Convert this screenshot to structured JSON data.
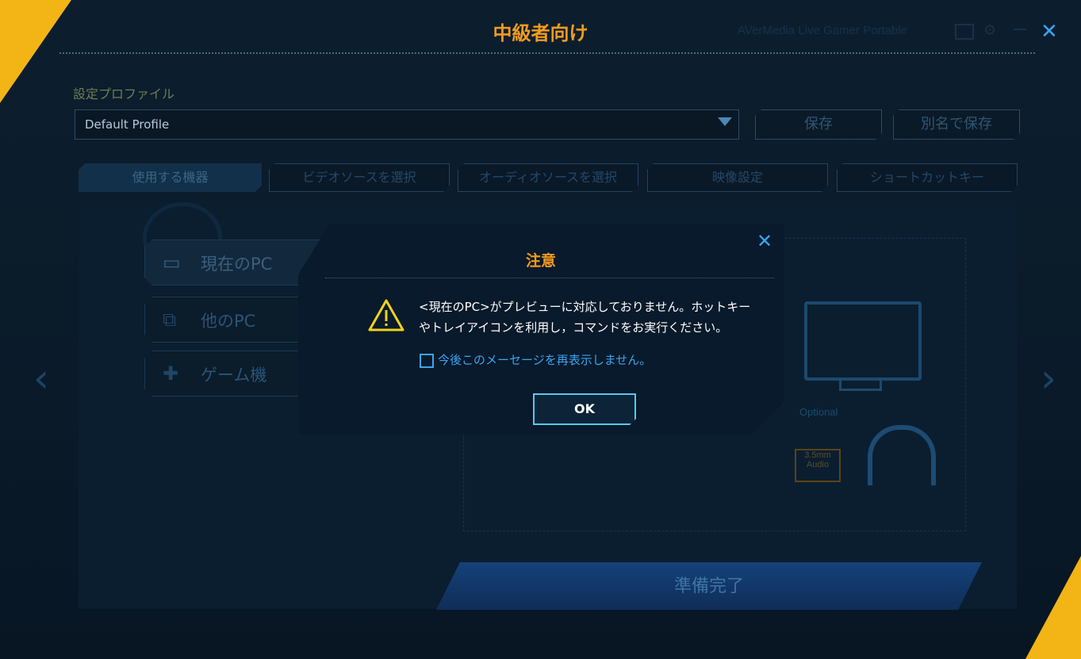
{
  "window": {
    "title": "中級者向け",
    "app_name": "AVerMedia Live Gamer Portable",
    "close_icon": "✕"
  },
  "profile": {
    "label": "設定プロファイル",
    "selected": "Default Profile",
    "save_label": "保存",
    "save_as_label": "別名で保存"
  },
  "tabs": [
    {
      "label": "使用する機器",
      "active": true
    },
    {
      "label": "ビデオソースを選択"
    },
    {
      "label": "オーディオソースを選択"
    },
    {
      "label": "映像設定"
    },
    {
      "label": "ショートカットキー"
    }
  ],
  "devices": [
    {
      "label": "現在のPC",
      "icon": "monitor-icon",
      "selected": true
    },
    {
      "label": "他のPC",
      "icon": "dual-monitor-icon"
    },
    {
      "label": "ゲーム機",
      "icon": "gamepad-icon"
    }
  ],
  "diagram": {
    "optional_label": "Optional",
    "audio_label_1": "3.5mm",
    "audio_label_2": "Audio"
  },
  "ready_button": "準備完了",
  "modal": {
    "title": "注意",
    "message_line1": "<現在のPC>がプレビューに対応しておりません。ホットキー",
    "message_line2": "やトレイアイコンを利用し，コマンドをお実行ください。",
    "checkbox_label": "今後このメーセージを再表示しません。",
    "checkbox_checked": false,
    "ok_label": "OK"
  },
  "colors": {
    "accent_orange": "#f29b1d",
    "accent_blue": "#36a6f2",
    "corner_yellow": "#f3b416",
    "warning_yellow": "#f1d21c"
  }
}
